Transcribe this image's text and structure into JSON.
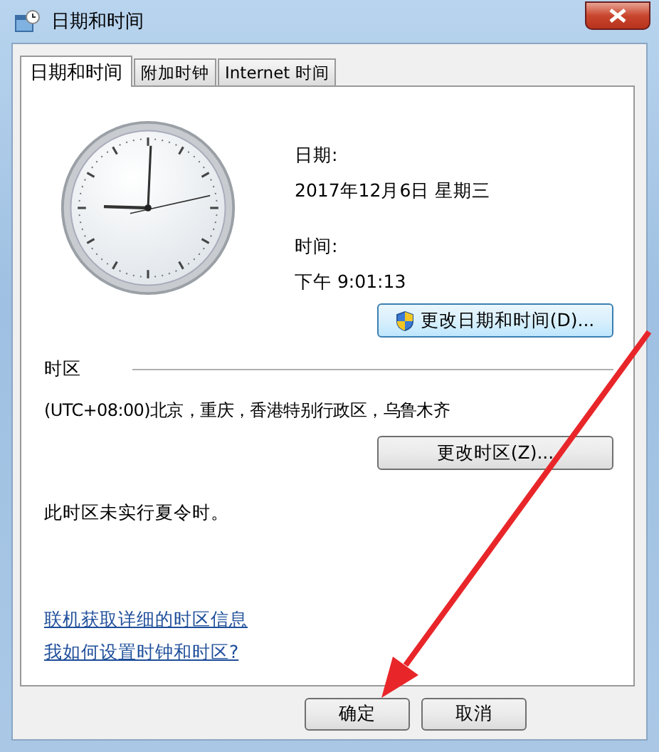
{
  "window": {
    "title": "日期和时间"
  },
  "tabs": [
    {
      "label": "日期和时间",
      "selected": true
    },
    {
      "label": "附加时钟",
      "selected": false
    },
    {
      "label": "Internet 时间",
      "selected": false
    }
  ],
  "date": {
    "label": "日期:",
    "value": "2017年12月6日 星期三"
  },
  "time": {
    "label": "时间:",
    "value": "下午 9:01:13"
  },
  "change_datetime_button": "更改日期和时间(D)...",
  "timezone": {
    "heading": "时区",
    "value": "(UTC+08:00)北京，重庆，香港特别行政区，乌鲁木齐",
    "button": "更改时区(Z)...",
    "dst_note": "此时区未实行夏令时。"
  },
  "links": [
    "联机获取详细的时区信息",
    "我如何设置时钟和时区?"
  ],
  "buttons": [
    "确定",
    "取消"
  ]
}
